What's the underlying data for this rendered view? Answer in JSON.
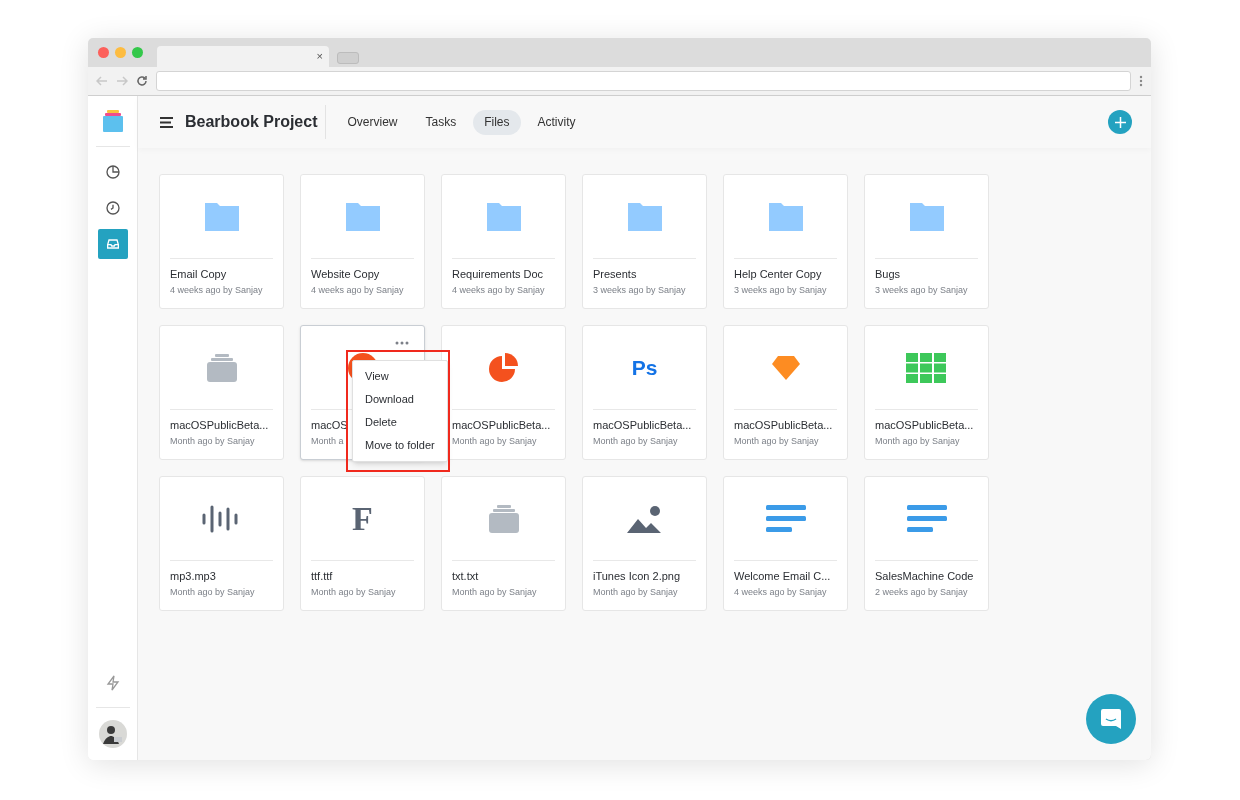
{
  "browser": {
    "tab_close": "×"
  },
  "header": {
    "title": "Bearbook Project",
    "tabs": [
      {
        "label": "Overview",
        "selected": false
      },
      {
        "label": "Tasks",
        "selected": false
      },
      {
        "label": "Files",
        "selected": true
      },
      {
        "label": "Activity",
        "selected": false
      }
    ]
  },
  "sidebar": {
    "items": [
      {
        "kind": "chart",
        "selected": false
      },
      {
        "kind": "clock",
        "selected": false
      },
      {
        "kind": "inbox",
        "selected": true
      }
    ]
  },
  "files": [
    {
      "kind": "folder",
      "name": "Email Copy",
      "meta": "4 weeks ago by Sanjay"
    },
    {
      "kind": "folder",
      "name": "Website Copy",
      "meta": "4 weeks ago by Sanjay"
    },
    {
      "kind": "folder",
      "name": "Requirements Doc",
      "meta": "4 weeks ago by Sanjay"
    },
    {
      "kind": "folder",
      "name": "Presents",
      "meta": "3 weeks ago by Sanjay"
    },
    {
      "kind": "folder",
      "name": "Help Center Copy",
      "meta": "3 weeks ago by Sanjay"
    },
    {
      "kind": "folder",
      "name": "Bugs",
      "meta": "3 weeks ago by Sanjay"
    },
    {
      "kind": "archive",
      "name": "macOSPublicBeta...",
      "meta": "Month ago by Sanjay"
    },
    {
      "kind": "hidden",
      "name": "macOS",
      "meta": "Month a",
      "menu": [
        "View",
        "Download",
        "Delete",
        "Move to folder"
      ]
    },
    {
      "kind": "pie",
      "name": "macOSPublicBeta...",
      "meta": "Month ago by Sanjay"
    },
    {
      "kind": "glyph",
      "glyph": "Ps",
      "name": "macOSPublicBeta...",
      "meta": "Month ago by Sanjay"
    },
    {
      "kind": "gem",
      "name": "macOSPublicBeta...",
      "meta": "Month ago by Sanjay"
    },
    {
      "kind": "grid",
      "name": "macOSPublicBeta...",
      "meta": "Month ago by Sanjay"
    },
    {
      "kind": "audio",
      "name": "mp3.mp3",
      "meta": "Month ago by Sanjay"
    },
    {
      "kind": "serif",
      "glyph": "F",
      "name": "ttf.ttf",
      "meta": "Month ago by Sanjay"
    },
    {
      "kind": "archive",
      "name": "txt.txt",
      "meta": "Month ago by Sanjay"
    },
    {
      "kind": "image",
      "name": "iTunes Icon 2.png",
      "meta": "Month ago by Sanjay"
    },
    {
      "kind": "doc",
      "name": "Welcome Email C...",
      "meta": "4 weeks ago by Sanjay"
    },
    {
      "kind": "doc",
      "name": "SalesMachine Code",
      "meta": "2 weeks ago by Sanjay"
    }
  ]
}
